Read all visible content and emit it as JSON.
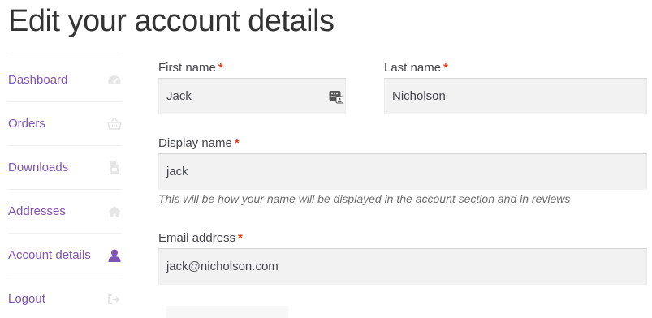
{
  "page": {
    "title": "Edit your account details"
  },
  "nav": {
    "items": [
      {
        "label": "Dashboard",
        "icon": "dashboard-icon"
      },
      {
        "label": "Orders",
        "icon": "basket-icon"
      },
      {
        "label": "Downloads",
        "icon": "file-icon"
      },
      {
        "label": "Addresses",
        "icon": "home-icon"
      },
      {
        "label": "Account details",
        "icon": "user-icon",
        "active": true
      },
      {
        "label": "Logout",
        "icon": "logout-icon"
      }
    ]
  },
  "form": {
    "required_marker": "*",
    "first_name": {
      "label": "First name",
      "value": "Jack"
    },
    "last_name": {
      "label": "Last name",
      "value": "Nicholson"
    },
    "display_name": {
      "label": "Display name",
      "value": "jack",
      "hint": "This will be how your name will be displayed in the account section and in reviews"
    },
    "email": {
      "label": "Email address",
      "value": "jack@nicholson.com"
    }
  },
  "colors": {
    "accent": "#7f54b3",
    "required": "#e2401c",
    "input_bg": "#f2f2f2"
  }
}
